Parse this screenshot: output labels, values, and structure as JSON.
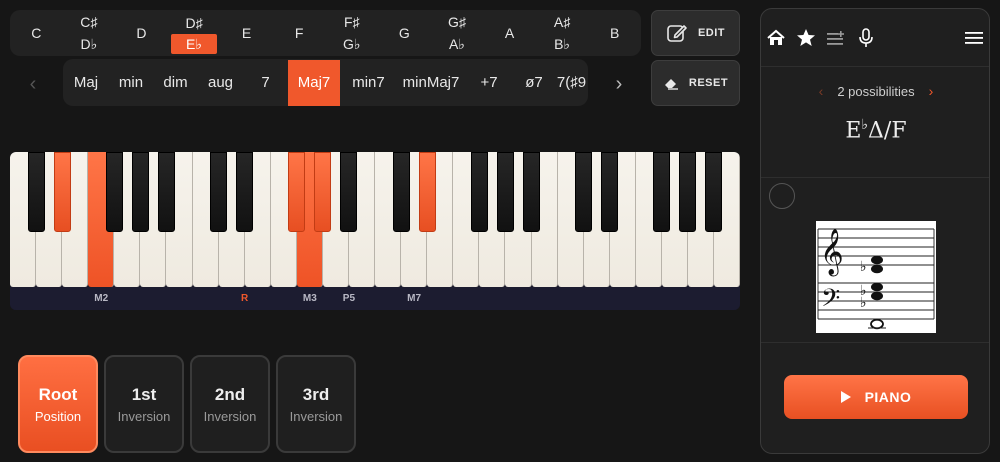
{
  "roots": [
    {
      "line1": "C",
      "line2": ""
    },
    {
      "line1": "C♯",
      "line2": "D♭"
    },
    {
      "line1": "D",
      "line2": ""
    },
    {
      "line1": "D♯",
      "line2": "E♭",
      "selected": true
    },
    {
      "line1": "E",
      "line2": ""
    },
    {
      "line1": "F",
      "line2": ""
    },
    {
      "line1": "F♯",
      "line2": "G♭"
    },
    {
      "line1": "G",
      "line2": ""
    },
    {
      "line1": "G♯",
      "line2": "A♭"
    },
    {
      "line1": "A",
      "line2": ""
    },
    {
      "line1": "A♯",
      "line2": "B♭"
    },
    {
      "line1": "B",
      "line2": ""
    }
  ],
  "qualities": [
    "Maj",
    "min",
    "dim",
    "aug",
    "7",
    "Maj7",
    "min7",
    "minMaj7",
    "+7",
    "ø7",
    "7(♯9"
  ],
  "selected_quality": "Maj7",
  "nav": {
    "prev": "‹",
    "next": "›"
  },
  "buttons": {
    "edit": "EDIT",
    "reset": "RESET"
  },
  "intervals": [
    {
      "label": "M2",
      "kind": "interval"
    },
    {
      "label": "R",
      "kind": "root"
    },
    {
      "label": "M3",
      "kind": "interval"
    },
    {
      "label": "P5",
      "kind": "interval"
    },
    {
      "label": "M7",
      "kind": "interval"
    }
  ],
  "inversions": [
    {
      "title": "Root",
      "sub": "Position",
      "selected": true
    },
    {
      "title": "1st",
      "sub": "Inversion"
    },
    {
      "title": "2nd",
      "sub": "Inversion"
    },
    {
      "title": "3rd",
      "sub": "Inversion"
    }
  ],
  "panel": {
    "possibilities": "2 possibilities",
    "chord_root": "E",
    "chord_acc": "♭",
    "chord_suffix": "Δ/F",
    "play_label": "PIANO"
  },
  "colors": {
    "accent": "#f0582c",
    "bg": "#161616",
    "panel": "#1f1f1f"
  },
  "icons": [
    "home-icon",
    "star-icon",
    "list-add-icon",
    "microphone-icon",
    "menu-icon",
    "pencil-icon",
    "eraser-icon",
    "play-icon"
  ]
}
